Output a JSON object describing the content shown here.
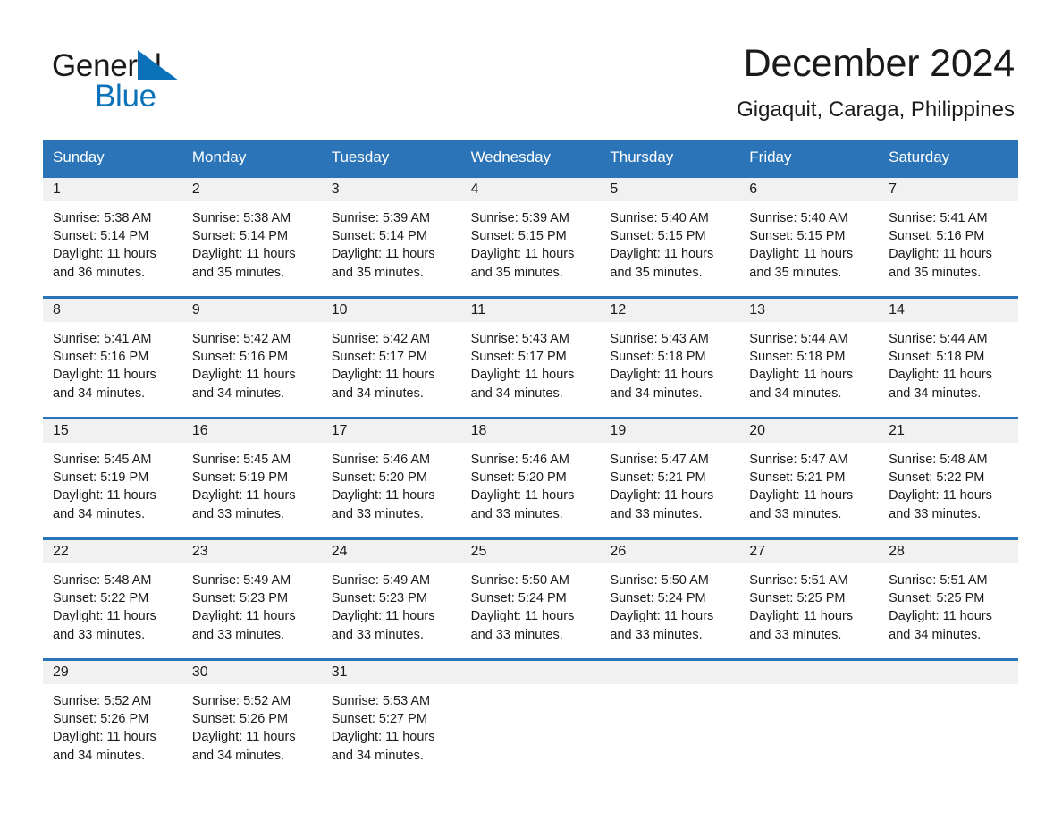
{
  "brand": {
    "name_part1": "General",
    "name_part2": "Blue",
    "triangle_color": "#0b72b9",
    "text_color": "#1a1a1a"
  },
  "header": {
    "month_title": "December 2024",
    "location": "Gigaquit, Caraga, Philippines"
  },
  "theme": {
    "header_blue": "#2b74b8",
    "day_band_gray": "#f1f1f1",
    "cell_white": "#ffffff",
    "text": "#1a1a1a"
  },
  "weekdays": [
    {
      "label": "Sunday"
    },
    {
      "label": "Monday"
    },
    {
      "label": "Tuesday"
    },
    {
      "label": "Wednesday"
    },
    {
      "label": "Thursday"
    },
    {
      "label": "Friday"
    },
    {
      "label": "Saturday"
    }
  ],
  "weeks": [
    {
      "days": [
        {
          "day": "1",
          "sunrise": "Sunrise: 5:38 AM",
          "sunset": "Sunset: 5:14 PM",
          "daylight_line1": "Daylight: 11 hours",
          "daylight_line2": "and 36 minutes."
        },
        {
          "day": "2",
          "sunrise": "Sunrise: 5:38 AM",
          "sunset": "Sunset: 5:14 PM",
          "daylight_line1": "Daylight: 11 hours",
          "daylight_line2": "and 35 minutes."
        },
        {
          "day": "3",
          "sunrise": "Sunrise: 5:39 AM",
          "sunset": "Sunset: 5:14 PM",
          "daylight_line1": "Daylight: 11 hours",
          "daylight_line2": "and 35 minutes."
        },
        {
          "day": "4",
          "sunrise": "Sunrise: 5:39 AM",
          "sunset": "Sunset: 5:15 PM",
          "daylight_line1": "Daylight: 11 hours",
          "daylight_line2": "and 35 minutes."
        },
        {
          "day": "5",
          "sunrise": "Sunrise: 5:40 AM",
          "sunset": "Sunset: 5:15 PM",
          "daylight_line1": "Daylight: 11 hours",
          "daylight_line2": "and 35 minutes."
        },
        {
          "day": "6",
          "sunrise": "Sunrise: 5:40 AM",
          "sunset": "Sunset: 5:15 PM",
          "daylight_line1": "Daylight: 11 hours",
          "daylight_line2": "and 35 minutes."
        },
        {
          "day": "7",
          "sunrise": "Sunrise: 5:41 AM",
          "sunset": "Sunset: 5:16 PM",
          "daylight_line1": "Daylight: 11 hours",
          "daylight_line2": "and 35 minutes."
        }
      ]
    },
    {
      "days": [
        {
          "day": "8",
          "sunrise": "Sunrise: 5:41 AM",
          "sunset": "Sunset: 5:16 PM",
          "daylight_line1": "Daylight: 11 hours",
          "daylight_line2": "and 34 minutes."
        },
        {
          "day": "9",
          "sunrise": "Sunrise: 5:42 AM",
          "sunset": "Sunset: 5:16 PM",
          "daylight_line1": "Daylight: 11 hours",
          "daylight_line2": "and 34 minutes."
        },
        {
          "day": "10",
          "sunrise": "Sunrise: 5:42 AM",
          "sunset": "Sunset: 5:17 PM",
          "daylight_line1": "Daylight: 11 hours",
          "daylight_line2": "and 34 minutes."
        },
        {
          "day": "11",
          "sunrise": "Sunrise: 5:43 AM",
          "sunset": "Sunset: 5:17 PM",
          "daylight_line1": "Daylight: 11 hours",
          "daylight_line2": "and 34 minutes."
        },
        {
          "day": "12",
          "sunrise": "Sunrise: 5:43 AM",
          "sunset": "Sunset: 5:18 PM",
          "daylight_line1": "Daylight: 11 hours",
          "daylight_line2": "and 34 minutes."
        },
        {
          "day": "13",
          "sunrise": "Sunrise: 5:44 AM",
          "sunset": "Sunset: 5:18 PM",
          "daylight_line1": "Daylight: 11 hours",
          "daylight_line2": "and 34 minutes."
        },
        {
          "day": "14",
          "sunrise": "Sunrise: 5:44 AM",
          "sunset": "Sunset: 5:18 PM",
          "daylight_line1": "Daylight: 11 hours",
          "daylight_line2": "and 34 minutes."
        }
      ]
    },
    {
      "days": [
        {
          "day": "15",
          "sunrise": "Sunrise: 5:45 AM",
          "sunset": "Sunset: 5:19 PM",
          "daylight_line1": "Daylight: 11 hours",
          "daylight_line2": "and 34 minutes."
        },
        {
          "day": "16",
          "sunrise": "Sunrise: 5:45 AM",
          "sunset": "Sunset: 5:19 PM",
          "daylight_line1": "Daylight: 11 hours",
          "daylight_line2": "and 33 minutes."
        },
        {
          "day": "17",
          "sunrise": "Sunrise: 5:46 AM",
          "sunset": "Sunset: 5:20 PM",
          "daylight_line1": "Daylight: 11 hours",
          "daylight_line2": "and 33 minutes."
        },
        {
          "day": "18",
          "sunrise": "Sunrise: 5:46 AM",
          "sunset": "Sunset: 5:20 PM",
          "daylight_line1": "Daylight: 11 hours",
          "daylight_line2": "and 33 minutes."
        },
        {
          "day": "19",
          "sunrise": "Sunrise: 5:47 AM",
          "sunset": "Sunset: 5:21 PM",
          "daylight_line1": "Daylight: 11 hours",
          "daylight_line2": "and 33 minutes."
        },
        {
          "day": "20",
          "sunrise": "Sunrise: 5:47 AM",
          "sunset": "Sunset: 5:21 PM",
          "daylight_line1": "Daylight: 11 hours",
          "daylight_line2": "and 33 minutes."
        },
        {
          "day": "21",
          "sunrise": "Sunrise: 5:48 AM",
          "sunset": "Sunset: 5:22 PM",
          "daylight_line1": "Daylight: 11 hours",
          "daylight_line2": "and 33 minutes."
        }
      ]
    },
    {
      "days": [
        {
          "day": "22",
          "sunrise": "Sunrise: 5:48 AM",
          "sunset": "Sunset: 5:22 PM",
          "daylight_line1": "Daylight: 11 hours",
          "daylight_line2": "and 33 minutes."
        },
        {
          "day": "23",
          "sunrise": "Sunrise: 5:49 AM",
          "sunset": "Sunset: 5:23 PM",
          "daylight_line1": "Daylight: 11 hours",
          "daylight_line2": "and 33 minutes."
        },
        {
          "day": "24",
          "sunrise": "Sunrise: 5:49 AM",
          "sunset": "Sunset: 5:23 PM",
          "daylight_line1": "Daylight: 11 hours",
          "daylight_line2": "and 33 minutes."
        },
        {
          "day": "25",
          "sunrise": "Sunrise: 5:50 AM",
          "sunset": "Sunset: 5:24 PM",
          "daylight_line1": "Daylight: 11 hours",
          "daylight_line2": "and 33 minutes."
        },
        {
          "day": "26",
          "sunrise": "Sunrise: 5:50 AM",
          "sunset": "Sunset: 5:24 PM",
          "daylight_line1": "Daylight: 11 hours",
          "daylight_line2": "and 33 minutes."
        },
        {
          "day": "27",
          "sunrise": "Sunrise: 5:51 AM",
          "sunset": "Sunset: 5:25 PM",
          "daylight_line1": "Daylight: 11 hours",
          "daylight_line2": "and 33 minutes."
        },
        {
          "day": "28",
          "sunrise": "Sunrise: 5:51 AM",
          "sunset": "Sunset: 5:25 PM",
          "daylight_line1": "Daylight: 11 hours",
          "daylight_line2": "and 34 minutes."
        }
      ]
    },
    {
      "days": [
        {
          "day": "29",
          "sunrise": "Sunrise: 5:52 AM",
          "sunset": "Sunset: 5:26 PM",
          "daylight_line1": "Daylight: 11 hours",
          "daylight_line2": "and 34 minutes."
        },
        {
          "day": "30",
          "sunrise": "Sunrise: 5:52 AM",
          "sunset": "Sunset: 5:26 PM",
          "daylight_line1": "Daylight: 11 hours",
          "daylight_line2": "and 34 minutes."
        },
        {
          "day": "31",
          "sunrise": "Sunrise: 5:53 AM",
          "sunset": "Sunset: 5:27 PM",
          "daylight_line1": "Daylight: 11 hours",
          "daylight_line2": "and 34 minutes."
        },
        {
          "day": "",
          "sunrise": "",
          "sunset": "",
          "daylight_line1": "",
          "daylight_line2": ""
        },
        {
          "day": "",
          "sunrise": "",
          "sunset": "",
          "daylight_line1": "",
          "daylight_line2": ""
        },
        {
          "day": "",
          "sunrise": "",
          "sunset": "",
          "daylight_line1": "",
          "daylight_line2": ""
        },
        {
          "day": "",
          "sunrise": "",
          "sunset": "",
          "daylight_line1": "",
          "daylight_line2": ""
        }
      ]
    }
  ]
}
